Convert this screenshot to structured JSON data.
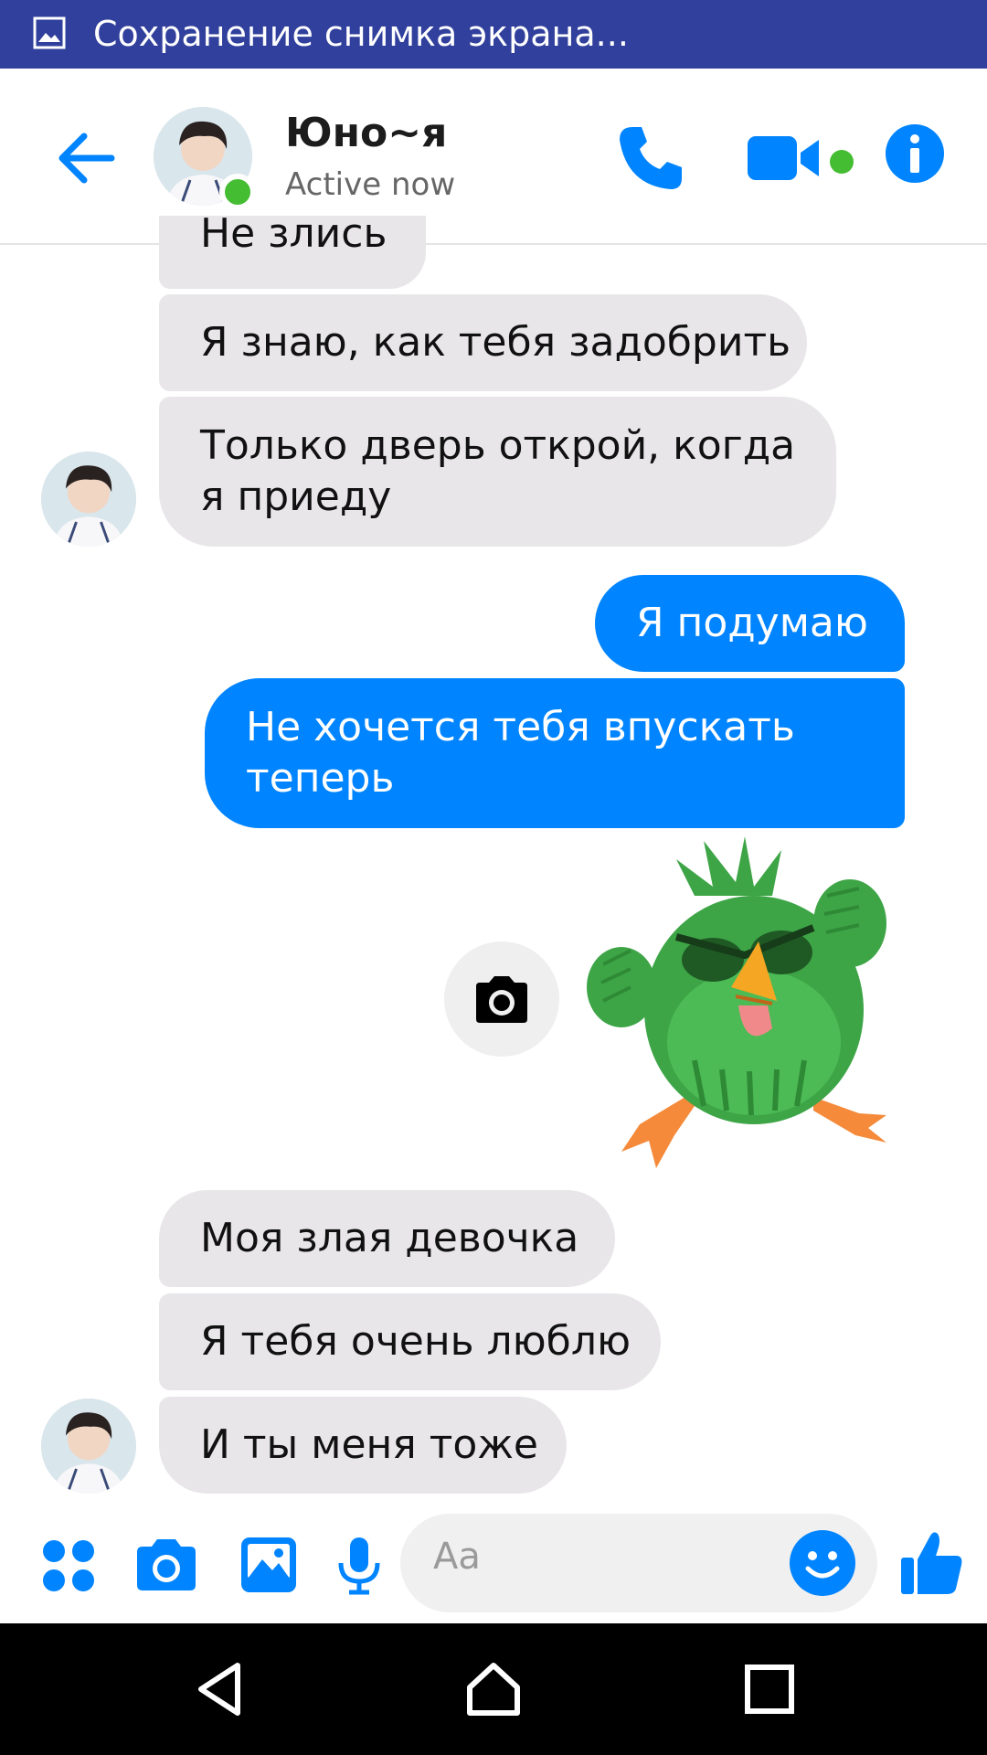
{
  "status_bar": {
    "text": "Сохранение снимка экрана...",
    "icon": "picture-icon",
    "color": "#30409c"
  },
  "header": {
    "name": "Юно~я",
    "status": "Active now",
    "icons": [
      "back-arrow-icon",
      "phone-icon",
      "video-camera-icon",
      "info-icon"
    ],
    "accent": "#0084ff",
    "online_color": "#44bd32"
  },
  "messages": [
    {
      "id": "m1",
      "direction": "incoming",
      "lines": [
        "Не злись"
      ]
    },
    {
      "id": "m2",
      "direction": "incoming",
      "lines": [
        "Я знаю, как тебя задобрить"
      ]
    },
    {
      "id": "m3",
      "direction": "incoming",
      "lines": [
        "Только дверь открой, когда",
        "я приеду"
      ]
    },
    {
      "id": "m4",
      "direction": "outgoing",
      "lines": [
        "Я подумаю"
      ]
    },
    {
      "id": "m5",
      "direction": "outgoing",
      "lines": [
        "Не хочется тебя впускать",
        "теперь"
      ]
    },
    {
      "id": "m6",
      "direction": "outgoing",
      "type": "sticker",
      "sticker": "angry-green-bird"
    },
    {
      "id": "m7",
      "direction": "incoming",
      "lines": [
        "Моя злая девочка"
      ]
    },
    {
      "id": "m8",
      "direction": "incoming",
      "lines": [
        "Я тебя очень люблю"
      ]
    },
    {
      "id": "m9",
      "direction": "incoming",
      "lines": [
        "И ты меня тоже"
      ]
    }
  ],
  "composer": {
    "placeholder": "Aa",
    "icons": [
      "apps-icon",
      "camera-icon",
      "gallery-icon",
      "microphone-icon",
      "emoji-icon",
      "thumbs-up-icon"
    ]
  },
  "nav_bar": {
    "icons": [
      "nav-back-icon",
      "nav-home-icon",
      "nav-recents-icon"
    ]
  },
  "colors": {
    "incoming_bubble": "#e8e6e9",
    "outgoing_bubble": "#0084ff"
  }
}
